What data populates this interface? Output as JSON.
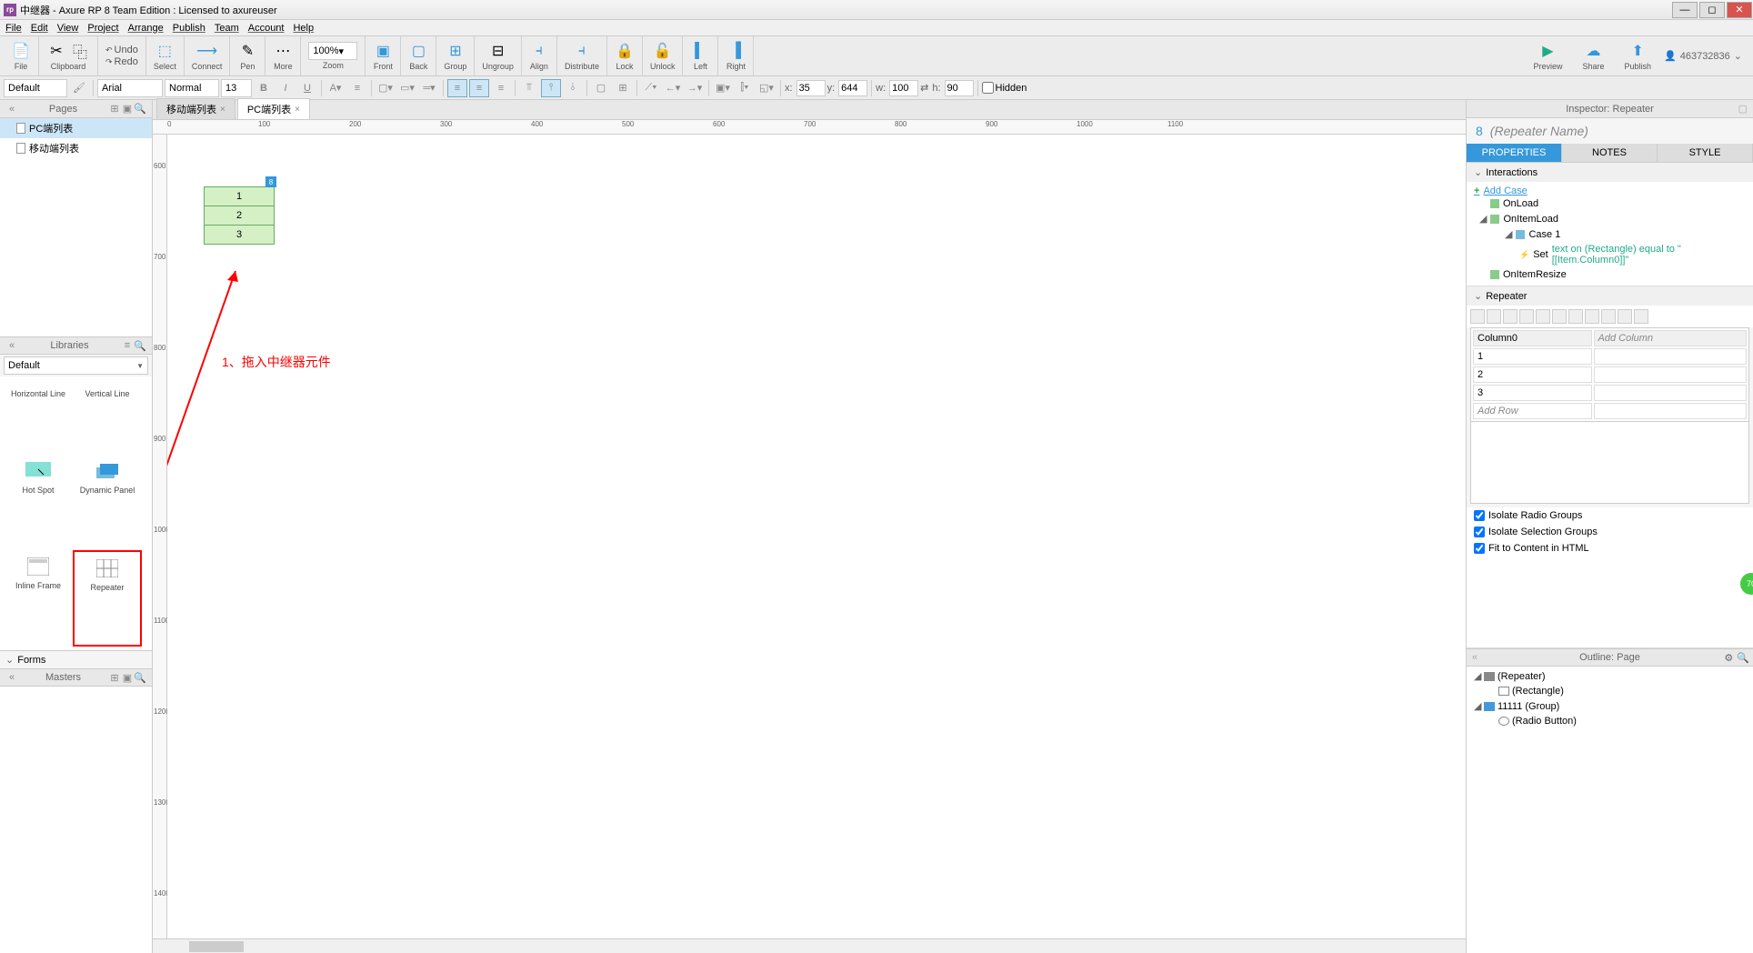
{
  "title": "中继器 - Axure RP 8 Team Edition : Licensed to axureuser",
  "menu": [
    "File",
    "Edit",
    "View",
    "Project",
    "Arrange",
    "Publish",
    "Team",
    "Account",
    "Help"
  ],
  "toolbar": {
    "file": "File",
    "clipboard": "Clipboard",
    "undo": "Undo",
    "redo": "Redo",
    "select": "Select",
    "connect": "Connect",
    "pen": "Pen",
    "more": "More",
    "zoom": "100%",
    "zoom_label": "Zoom",
    "front": "Front",
    "back": "Back",
    "group": "Group",
    "ungroup": "Ungroup",
    "align": "Align",
    "distribute": "Distribute",
    "lock": "Lock",
    "unlock": "Unlock",
    "left": "Left",
    "right": "Right",
    "preview": "Preview",
    "share": "Share",
    "publish": "Publish",
    "user": "463732836"
  },
  "format": {
    "style_preset": "Default",
    "font": "Arial",
    "font_style": "Normal",
    "size": "13",
    "x_label": "x:",
    "x": "35",
    "y_label": "y:",
    "y": "644",
    "w_label": "w:",
    "w": "100",
    "h_label": "h:",
    "h": "90",
    "hidden": "Hidden"
  },
  "pages": {
    "header": "Pages",
    "items": [
      "PC端列表",
      "移动端列表"
    ]
  },
  "libraries": {
    "header": "Libraries",
    "set": "Default",
    "row_labels": [
      "Horizontal Line",
      "Vertical Line",
      "Hot Spot",
      "Dynamic Panel",
      "Inline Frame",
      "Repeater"
    ],
    "forms": "Forms"
  },
  "masters": {
    "header": "Masters"
  },
  "tabs": [
    {
      "label": "移动端列表",
      "active": false
    },
    {
      "label": "PC端列表",
      "active": true
    }
  ],
  "ruler_h": [
    "0",
    "100",
    "200",
    "300",
    "400",
    "500",
    "600",
    "700",
    "800",
    "900",
    "1000",
    "1100"
  ],
  "ruler_v": [
    "600",
    "700",
    "800",
    "900",
    "1000",
    "1100",
    "1200",
    "1300",
    "1400"
  ],
  "repeater_rows": [
    "1",
    "2",
    "3"
  ],
  "repeater_badge": "8",
  "annotation": "1、拖入中继器元件",
  "inspector": {
    "title": "Inspector: Repeater",
    "count": "8",
    "name": "(Repeater Name)",
    "tabs": [
      "PROPERTIES",
      "NOTES",
      "STYLE"
    ],
    "interactions": "Interactions",
    "add_case": "Add Case",
    "events": {
      "onload": "OnLoad",
      "onitemload": "OnItemLoad",
      "case1": "Case 1",
      "action_pre": "Set ",
      "action_hl": "text on (Rectangle) equal to \"[[Item.Column0]]\"",
      "onitemresize": "OnItemResize"
    },
    "repeater_section": "Repeater",
    "columns": [
      "Column0"
    ],
    "add_column": "Add Column",
    "rows": [
      "1",
      "2",
      "3"
    ],
    "add_row": "Add Row",
    "checks": [
      "Isolate Radio Groups",
      "Isolate Selection Groups",
      "Fit to Content in HTML"
    ]
  },
  "outline": {
    "title": "Outline: Page",
    "items": [
      {
        "label": "(Repeater)",
        "indent": 0,
        "tri": "◢",
        "icon": "grid"
      },
      {
        "label": "(Rectangle)",
        "indent": 1,
        "tri": "",
        "icon": "rect"
      },
      {
        "label": "11111 (Group)",
        "indent": 0,
        "tri": "◢",
        "icon": "folder"
      },
      {
        "label": "(Radio Button)",
        "indent": 1,
        "tri": "",
        "icon": "radio"
      }
    ]
  }
}
